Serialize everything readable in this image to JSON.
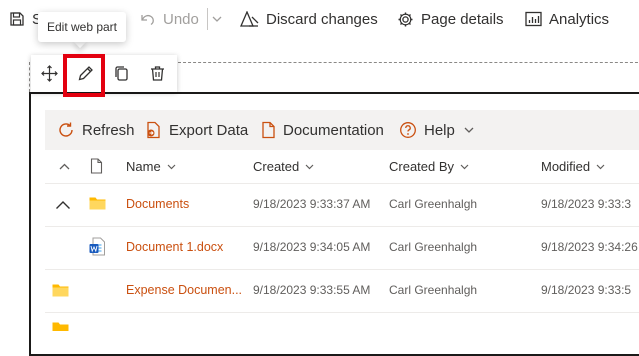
{
  "toolbar": {
    "save_label": "S",
    "undo_label": "Undo",
    "discard_label": "Discard changes",
    "page_details_label": "Page details",
    "analytics_label": "Analytics"
  },
  "tooltip": {
    "text": "Edit web part"
  },
  "webpart_toolbar": {
    "move_icon": "move-icon",
    "edit_icon": "pencil-icon",
    "duplicate_icon": "copy-icon",
    "delete_icon": "trash-icon"
  },
  "list_toolbar": {
    "refresh_label": "Refresh",
    "export_label": "Export Data",
    "documentation_label": "Documentation",
    "help_label": "Help"
  },
  "columns": {
    "name": "Name",
    "created": "Created",
    "created_by": "Created By",
    "modified": "Modified"
  },
  "rows": [
    {
      "name": "Documents",
      "created": "9/18/2023 9:33:37 AM",
      "created_by": "Carl Greenhalgh",
      "modified": "9/18/2023 9:33:3",
      "icon": "folder-icon",
      "expanded": true
    },
    {
      "name": "Document 1.docx",
      "created": "9/18/2023 9:34:05 AM",
      "created_by": "Carl Greenhalgh",
      "modified": "9/18/2023 9:34:26",
      "icon": "word-doc-icon"
    },
    {
      "name": "Expense Documen...",
      "created": "9/18/2023 9:33:55 AM",
      "created_by": "Carl Greenhalgh",
      "modified": "9/18/2023 9:33:5",
      "icon": "folder-icon"
    }
  ],
  "colors": {
    "accent_orange": "#ca5010",
    "folder_yellow": "#ffb900",
    "highlight_red": "#e3000f",
    "word_blue": "#185abd"
  }
}
